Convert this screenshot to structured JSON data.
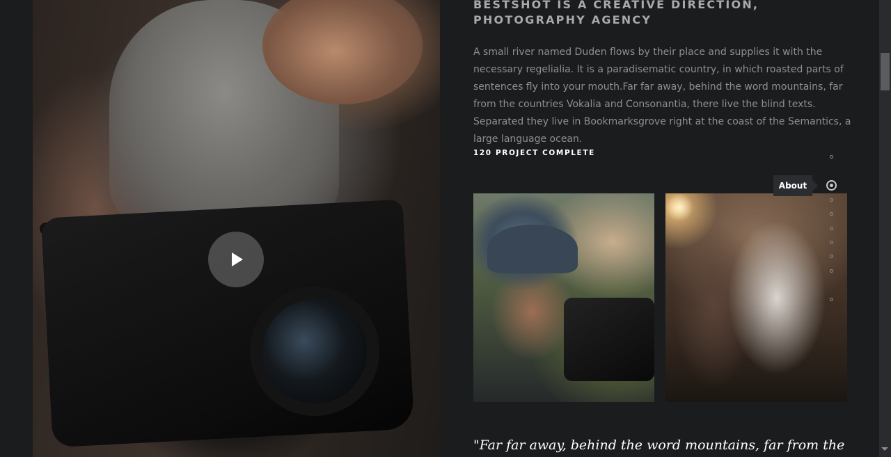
{
  "about": {
    "heading_line1": "BESTSHOT IS A CREATIVE DIRECTION,",
    "heading_line2": "PHOTOGRAPHY AGENCY",
    "intro": "A small river named Duden flows by their place and supplies it with the necessary regelialia. It is a paradisematic country, in which roasted parts of sentences fly into your mouth.Far far away, behind the word mountains, far from the countries Vokalia and Consonantia, there live the blind texts. Separated they live in Bookmarksgrove right at the coast of the Semantics, a large language ocean.",
    "stat_label": "120 PROJECT COMPLETE",
    "quote": "\"Far far away, behind the word mountains, far from the"
  },
  "video": {
    "play_icon": "play-icon"
  },
  "side_nav": {
    "active_label": "About"
  },
  "colors": {
    "background": "#1b1c1e",
    "heading": "#a9aaae",
    "body_text": "#8e8f93",
    "stat_text": "#ffffff"
  }
}
